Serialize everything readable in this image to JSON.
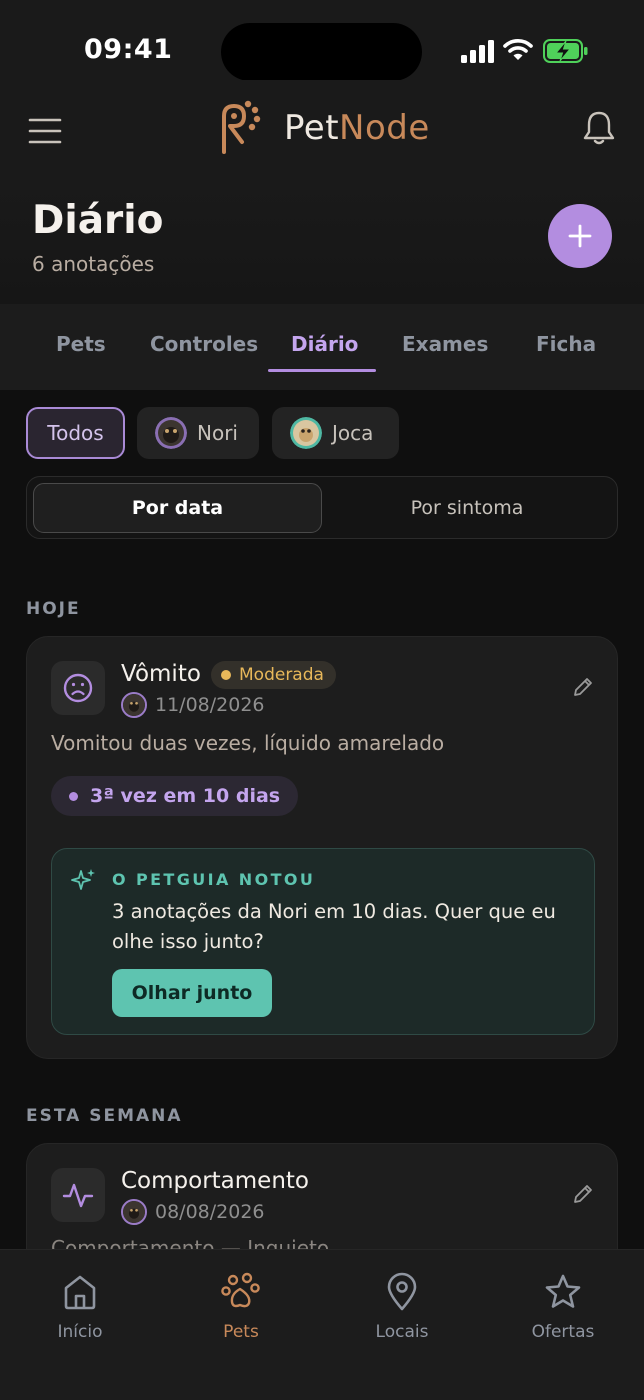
{
  "status_bar": {
    "time": "09:41"
  },
  "app": {
    "name_part1": "Pet",
    "name_part2": "Node"
  },
  "header": {
    "title": "Diário",
    "subtitle": "6 anotações"
  },
  "tabs": [
    {
      "label": "Pets"
    },
    {
      "label": "Controles"
    },
    {
      "label": "Diário",
      "active": true
    },
    {
      "label": "Exames"
    },
    {
      "label": "Ficha"
    }
  ],
  "filters": {
    "all": "Todos",
    "pets": [
      {
        "name": "Nori"
      },
      {
        "name": "Joca"
      }
    ]
  },
  "view_toggle": {
    "by_date": "Por data",
    "by_symptom": "Por sintoma",
    "selected": "Por data"
  },
  "sections": [
    {
      "label": "HOJE",
      "entry": {
        "icon": "sad-face-icon",
        "title": "Vômito",
        "severity": "Moderada",
        "date": "11/08/2026",
        "note": "Vomitou duas vezes, líquido amarelado",
        "pattern_badge": "3ª vez em 10 dias",
        "insight": {
          "label": "O PETGUIA NOTOU",
          "text": "3 anotações da Nori em 10 dias. Quer que eu olhe isso junto?",
          "button": "Olhar junto"
        }
      }
    },
    {
      "label": "ESTA SEMANA",
      "entry": {
        "icon": "activity-icon",
        "title": "Comportamento",
        "date": "08/08/2026",
        "note": "Comportamento — Inquieto"
      }
    }
  ],
  "bottom_nav": [
    {
      "label": "Início",
      "icon": "home-icon"
    },
    {
      "label": "Pets",
      "icon": "paw-icon",
      "active": true
    },
    {
      "label": "Locais",
      "icon": "location-pin-icon"
    },
    {
      "label": "Ofertas",
      "icon": "star-icon"
    }
  ],
  "colors": {
    "background": "#0f0f0f",
    "accent_purple": "#b38de0",
    "accent_brand": "#c8895a",
    "accent_teal": "#5ec4b0",
    "severity_moderate": "#e8b85a"
  }
}
